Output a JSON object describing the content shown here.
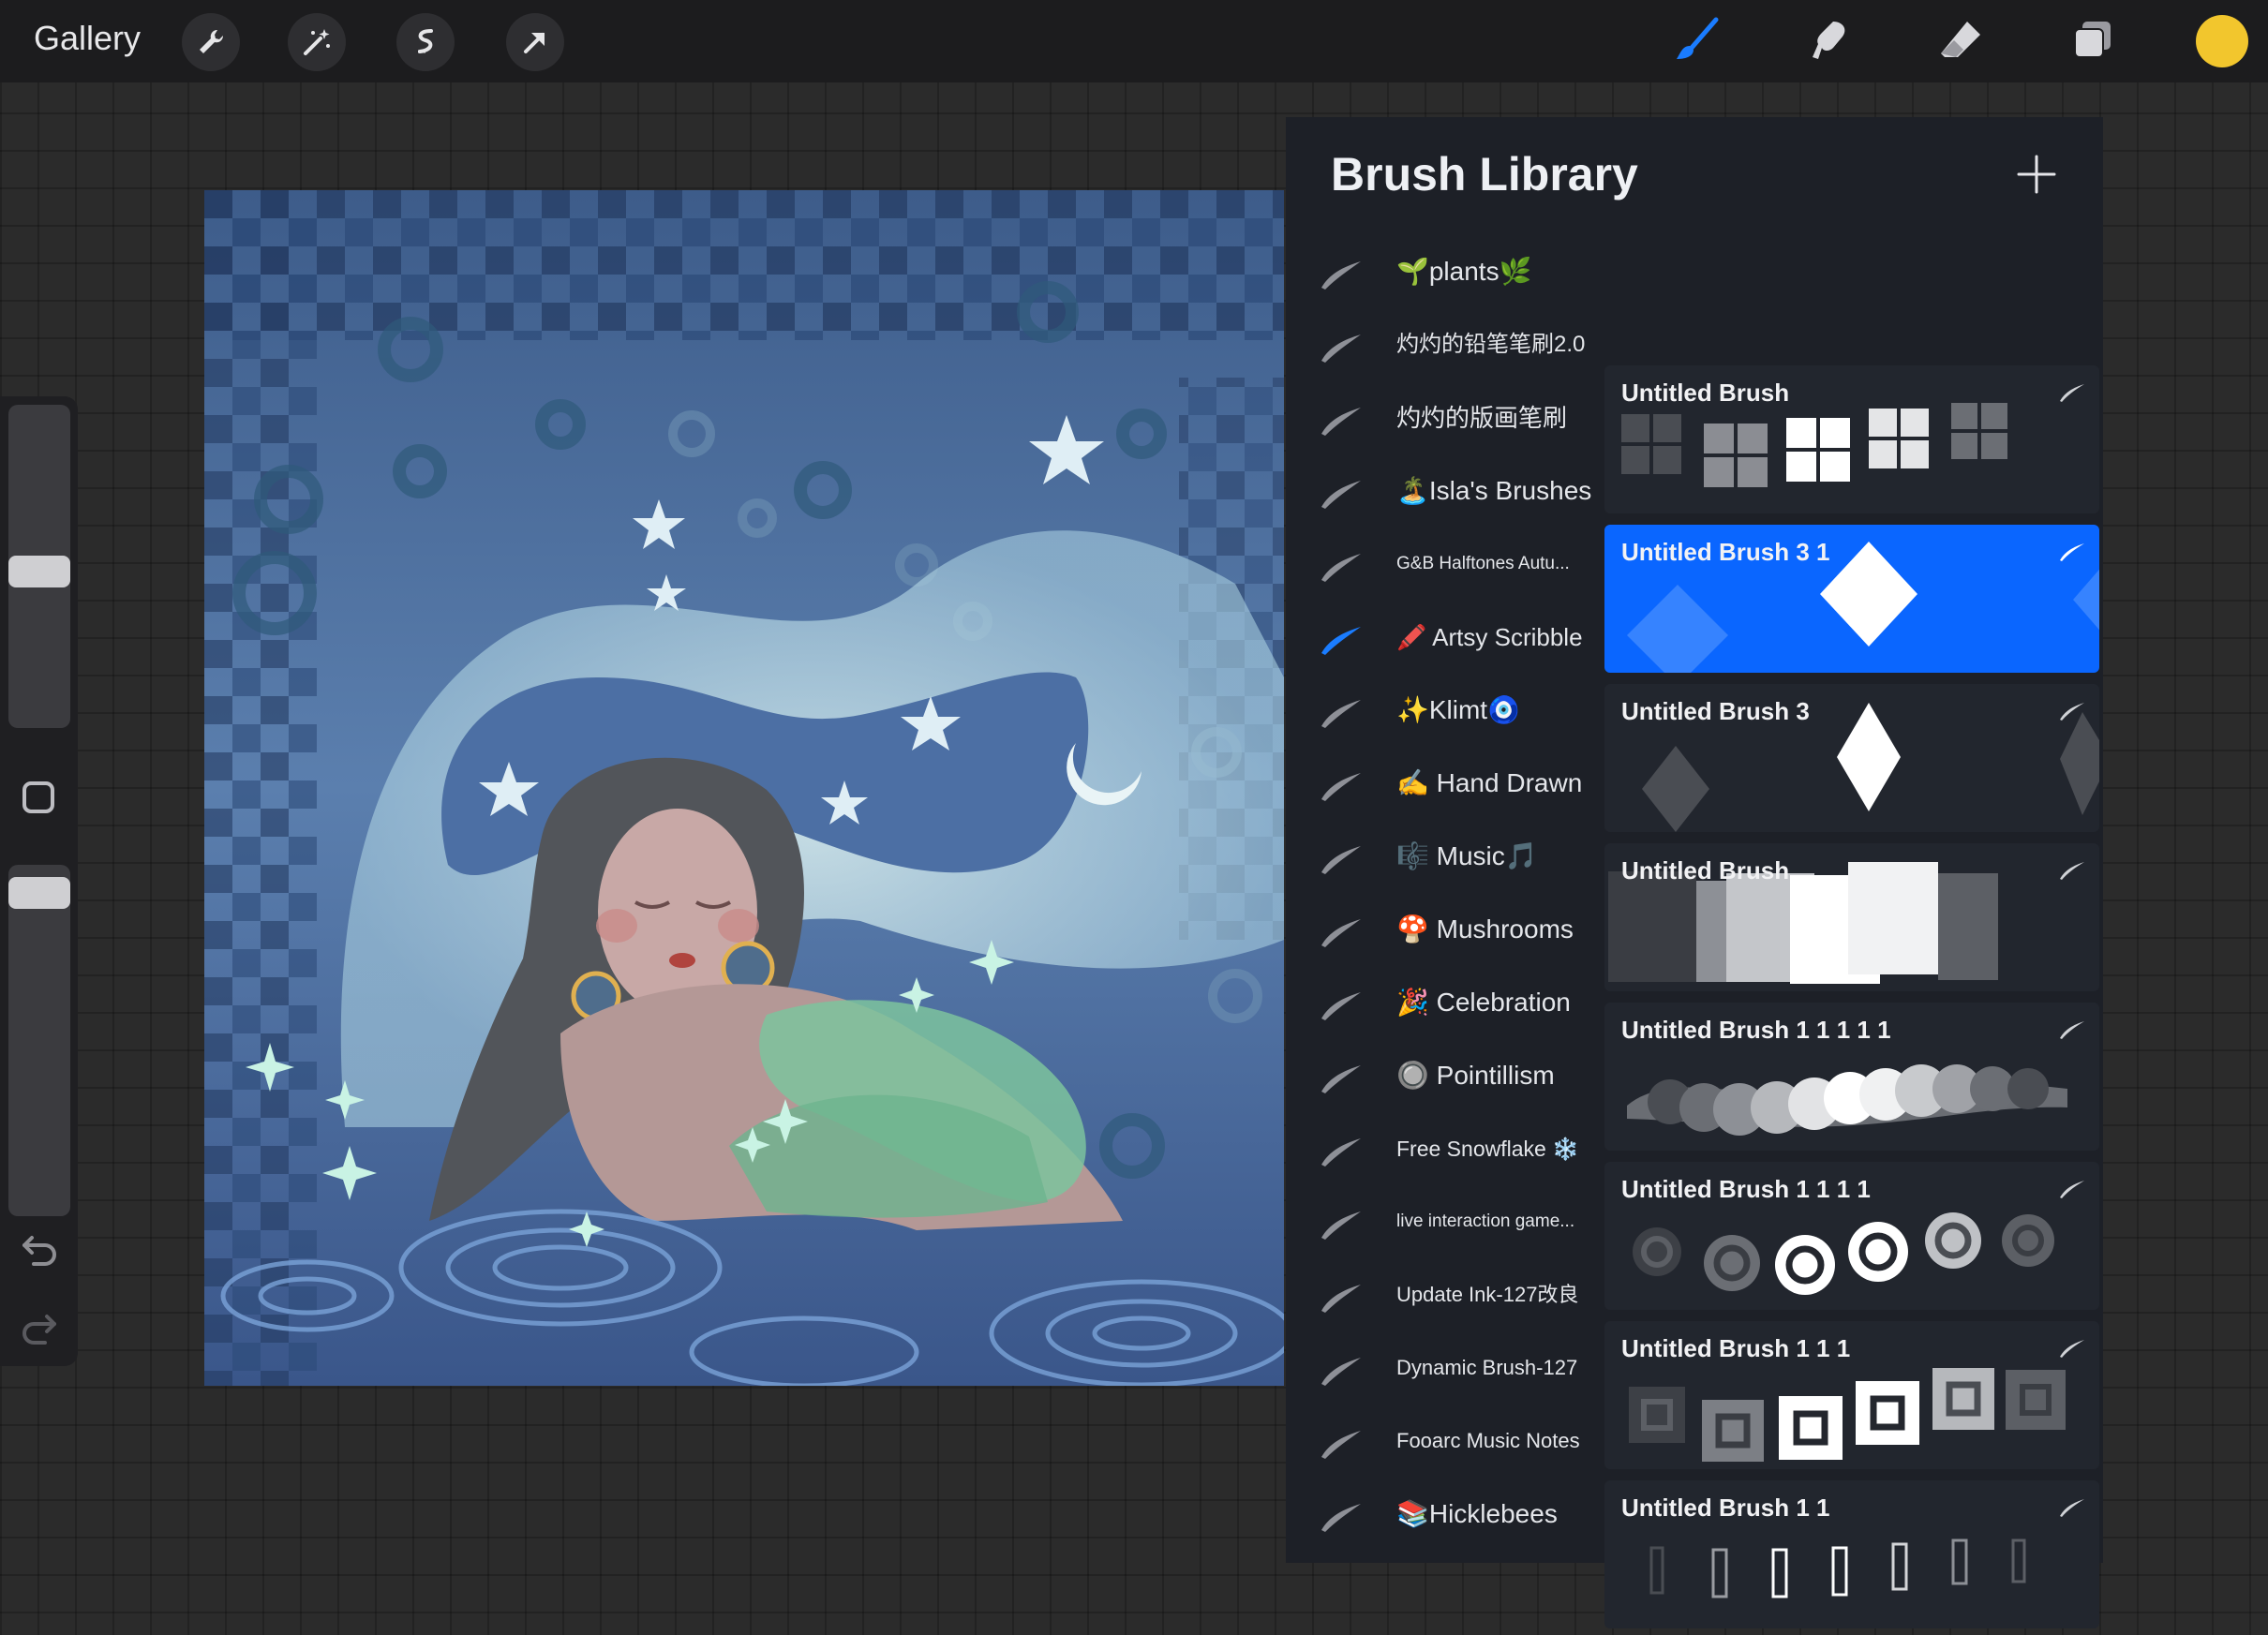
{
  "topbar": {
    "gallery_label": "Gallery",
    "left_tools": [
      "wrench-icon",
      "magic-wand-icon",
      "selection-icon",
      "transform-arrow-icon"
    ],
    "right_tools": [
      "brush-icon",
      "smudge-icon",
      "eraser-icon",
      "layers-icon"
    ],
    "active_tool": "brush-icon",
    "current_color": "#f2c62d"
  },
  "sidebar": {
    "controls": [
      "brush-size-slider",
      "modify-button",
      "opacity-slider",
      "undo-icon",
      "redo-icon"
    ]
  },
  "brush_library": {
    "title": "Brush Library",
    "add_icon": "plus-icon",
    "selected_set": "🖍️ Artsy Scribble",
    "sets": [
      {
        "label": "🌱plants🌿"
      },
      {
        "label": "灼灼的铅笔笔刷2.0"
      },
      {
        "label": "灼灼的版画笔刷"
      },
      {
        "label": "🏝️Isla's Brushes"
      },
      {
        "label": "G&B Halftones Autu..."
      },
      {
        "label": "🖍️ Artsy Scribble"
      },
      {
        "label": "✨Klimt🧿"
      },
      {
        "label": "✍️ Hand Drawn"
      },
      {
        "label": "🎼 Music🎵"
      },
      {
        "label": "🍄 Mushrooms"
      },
      {
        "label": "🎉 Celebration"
      },
      {
        "label": "🔘 Pointillism"
      },
      {
        "label": "Free Snowflake ❄️"
      },
      {
        "label": "live interaction game..."
      },
      {
        "label": "Update Ink-127改良"
      },
      {
        "label": "Dynamic Brush-127"
      },
      {
        "label": "Fooarc Music Notes"
      },
      {
        "label": "📚Hicklebees"
      }
    ],
    "brushes": [
      {
        "name": "Untitled Brush"
      },
      {
        "name": "Untitled Brush 3 1"
      },
      {
        "name": "Untitled Brush 3"
      },
      {
        "name": "Untitled Brush"
      },
      {
        "name": "Untitled Brush 1 1 1 1 1"
      },
      {
        "name": "Untitled Brush 1 1 1 1"
      },
      {
        "name": "Untitled Brush 1 1 1"
      },
      {
        "name": "Untitled Brush 1 1"
      }
    ],
    "selected_brush": "Untitled Brush 3 1",
    "accent_color": "#0a66ff"
  }
}
